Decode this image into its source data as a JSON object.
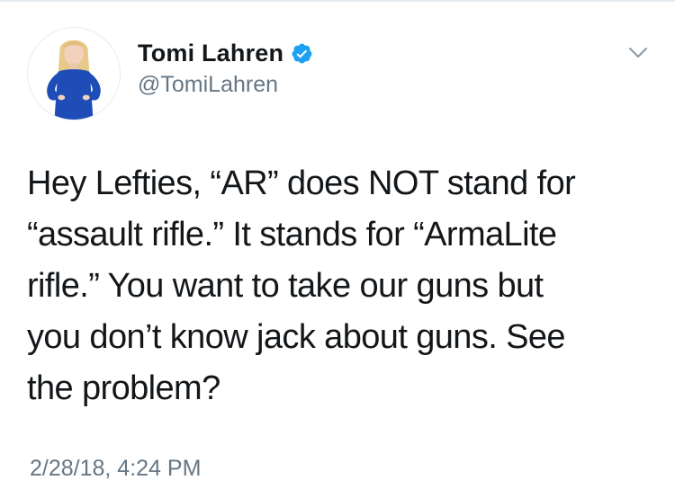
{
  "tweet": {
    "author": {
      "display_name": "Tomi Lahren",
      "handle": "@TomiLahren",
      "verified": true,
      "avatar_icon": "profile-photo-avatar"
    },
    "text": "Hey Lefties, “AR” does NOT stand for\n“assault rifle.” It stands for “ArmaLite\nrifle.” You want to take our guns but\nyou don’t know jack about guns. See\nthe problem?",
    "timestamp": "2/28/18, 4:24 PM"
  },
  "icons": {
    "verified": "verified-badge-icon",
    "menu": "chevron-down-icon"
  },
  "colors": {
    "verified_blue": "#1da1f2",
    "secondary_text": "#657786",
    "primary_text": "#14171a",
    "divider": "#e6ecf0"
  }
}
